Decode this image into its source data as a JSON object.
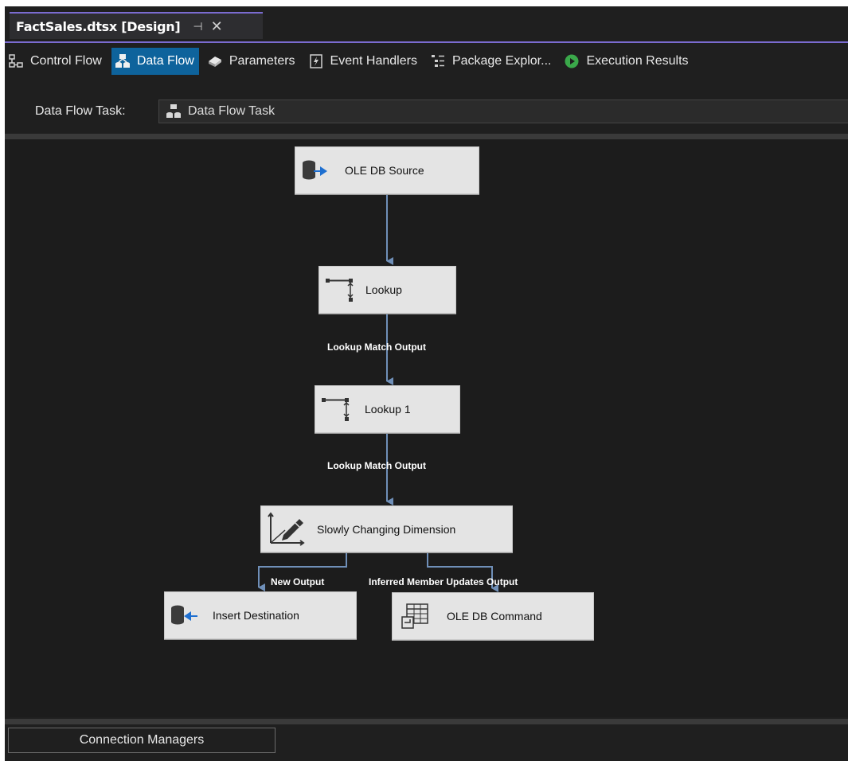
{
  "document_tab": {
    "title": "FactSales.dtsx [Design]",
    "pin_glyph": "⊣",
    "close_glyph": "✕"
  },
  "designer_tabs": [
    {
      "label": "Control Flow",
      "icon": "control-flow-icon",
      "active": false
    },
    {
      "label": "Data Flow",
      "icon": "data-flow-icon",
      "active": true
    },
    {
      "label": "Parameters",
      "icon": "parameters-icon",
      "active": false
    },
    {
      "label": "Event Handlers",
      "icon": "event-handlers-icon",
      "active": false
    },
    {
      "label": "Package Explor...",
      "icon": "package-explorer-icon",
      "active": false
    },
    {
      "label": "Execution Results",
      "icon": "execution-results-icon",
      "active": false
    }
  ],
  "task_selector": {
    "label": "Data Flow Task:",
    "value": "Data Flow Task"
  },
  "components": {
    "ole_db_source": "OLE DB Source",
    "lookup": "Lookup",
    "lookup1": "Lookup 1",
    "scd": "Slowly Changing Dimension",
    "insert_destination": "Insert Destination",
    "ole_db_command": "OLE DB Command"
  },
  "paths": {
    "lookup_match_1": "Lookup Match Output",
    "lookup_match_2": "Lookup Match Output",
    "new_output": "New Output",
    "inferred_output": "Inferred Member Updates Output"
  },
  "connection_managers": {
    "label": "Connection Managers"
  },
  "colors": {
    "background": "#1f1f1f",
    "accent_purple": "#7a6bd0",
    "active_tab": "#0e639c",
    "component_fill": "#e4e4e4",
    "path_line": "#6f8fb8"
  }
}
